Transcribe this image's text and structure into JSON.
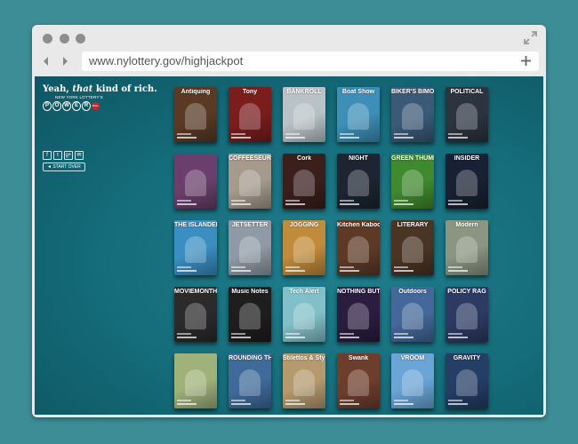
{
  "browser": {
    "url": "www.nylottery.gov/highjackpot"
  },
  "site": {
    "tagline_pre": "Yeah, ",
    "tagline_em": "that",
    "tagline_post": " kind of rich.",
    "subtitle": "NEW YORK LOTTERY'S",
    "powerball_letters": [
      "P",
      "O",
      "W",
      "E",
      "R"
    ],
    "ball_label": "BALL",
    "social": [
      "f",
      "t",
      "g+",
      "✉"
    ],
    "start_over": "◄ START OVER"
  },
  "covers": [
    {
      "title": "Antiquing",
      "bg": "#5a3a24"
    },
    {
      "title": "Tony",
      "bg": "#7a1d1d"
    },
    {
      "title": "BANKROLL",
      "bg": "#b9c3c7"
    },
    {
      "title": "Boat Show",
      "bg": "#3d8fb8"
    },
    {
      "title": "BIKER'S BIMONTHLY",
      "bg": "#3b5a78"
    },
    {
      "title": "POLITICAL",
      "bg": "#2c3440"
    },
    {
      "title": "",
      "bg": "#6a3f6d"
    },
    {
      "title": "COFFEESEUR",
      "bg": "#a59a8c"
    },
    {
      "title": "Cork",
      "bg": "#3a1f1c"
    },
    {
      "title": "NIGHT",
      "bg": "#1c2531"
    },
    {
      "title": "GREEN THUMB",
      "bg": "#3f8a2e"
    },
    {
      "title": "INSIDER",
      "bg": "#182133"
    },
    {
      "title": "THE ISLANDER",
      "bg": "#3a8ec2"
    },
    {
      "title": "JETSETTER",
      "bg": "#8f9aa6"
    },
    {
      "title": "JOGGING",
      "bg": "#c08b3a"
    },
    {
      "title": "Kitchen Kaboodle",
      "bg": "#5e3a26"
    },
    {
      "title": "LITERARY",
      "bg": "#4a3424"
    },
    {
      "title": "Modern",
      "bg": "#8a9582"
    },
    {
      "title": "MOVIEMONTHLY",
      "bg": "#2b2b2b"
    },
    {
      "title": "Music Notes",
      "bg": "#1e1e1e"
    },
    {
      "title": "Tech Alert",
      "bg": "#82c0c9"
    },
    {
      "title": "NOTHING BUT NET",
      "bg": "#2a1d40"
    },
    {
      "title": "Outdoors",
      "bg": "#44689a"
    },
    {
      "title": "POLICY RAG",
      "bg": "#2d3a63"
    },
    {
      "title": "",
      "bg": "#9fb27a"
    },
    {
      "title": "ROUNDING THIRD",
      "bg": "#3f6b9a"
    },
    {
      "title": "Stilettos & Style",
      "bg": "#b59a6e"
    },
    {
      "title": "Swank",
      "bg": "#6e3e2d"
    },
    {
      "title": "VROOM",
      "bg": "#6aa5d6"
    },
    {
      "title": "GRAVITY",
      "bg": "#243e66"
    }
  ]
}
